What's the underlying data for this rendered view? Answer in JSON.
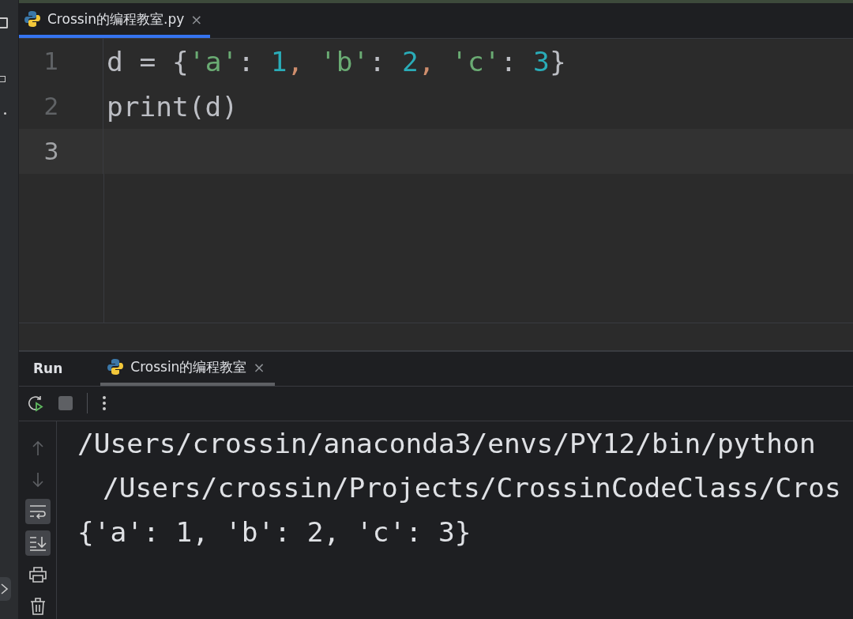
{
  "editor_tabs": [
    {
      "label": "Crossin的编程教室.py",
      "selected": true,
      "close": "×"
    }
  ],
  "editor": {
    "lines": [
      {
        "number": "1",
        "current": false,
        "tokens": [
          {
            "kind": "ident",
            "text": "d "
          },
          {
            "kind": "ident",
            "text": "= {"
          },
          {
            "kind": "string",
            "text": "'a'"
          },
          {
            "kind": "ident",
            "text": ": "
          },
          {
            "kind": "number",
            "text": "1"
          },
          {
            "kind": "punct",
            "text": ", "
          },
          {
            "kind": "string",
            "text": "'b'"
          },
          {
            "kind": "ident",
            "text": ": "
          },
          {
            "kind": "number",
            "text": "2"
          },
          {
            "kind": "punct",
            "text": ", "
          },
          {
            "kind": "string",
            "text": "'c'"
          },
          {
            "kind": "ident",
            "text": ": "
          },
          {
            "kind": "number",
            "text": "3"
          },
          {
            "kind": "ident",
            "text": "}"
          }
        ]
      },
      {
        "number": "2",
        "current": false,
        "tokens": [
          {
            "kind": "ident",
            "text": "print(d)"
          }
        ]
      },
      {
        "number": "3",
        "current": true
      }
    ]
  },
  "run_panel": {
    "title": "Run",
    "tabs": [
      {
        "label": "Crossin的编程教室",
        "selected": true,
        "close": "×"
      }
    ],
    "toolbar": [
      {
        "kind": "rerun"
      },
      {
        "kind": "stop"
      },
      {
        "kind": "more"
      }
    ],
    "side_tools": [
      {
        "kind": "up",
        "on": false
      },
      {
        "kind": "down",
        "on": false
      },
      {
        "kind": "wrap",
        "on": true
      },
      {
        "kind": "scroll-end",
        "on": true
      },
      {
        "kind": "print",
        "on": false
      },
      {
        "kind": "trash",
        "on": false
      }
    ],
    "output": [
      {
        "kind": "line",
        "text": "/Users/crossin/anaconda3/envs/PY12/bin/python"
      },
      {
        "kind": "continuation",
        "text": "/Users/crossin/Projects/CrossinCodeClass/Cros"
      },
      {
        "kind": "line",
        "text": "{'a': 1, 'b': 2, 'c': 3}"
      }
    ]
  }
}
